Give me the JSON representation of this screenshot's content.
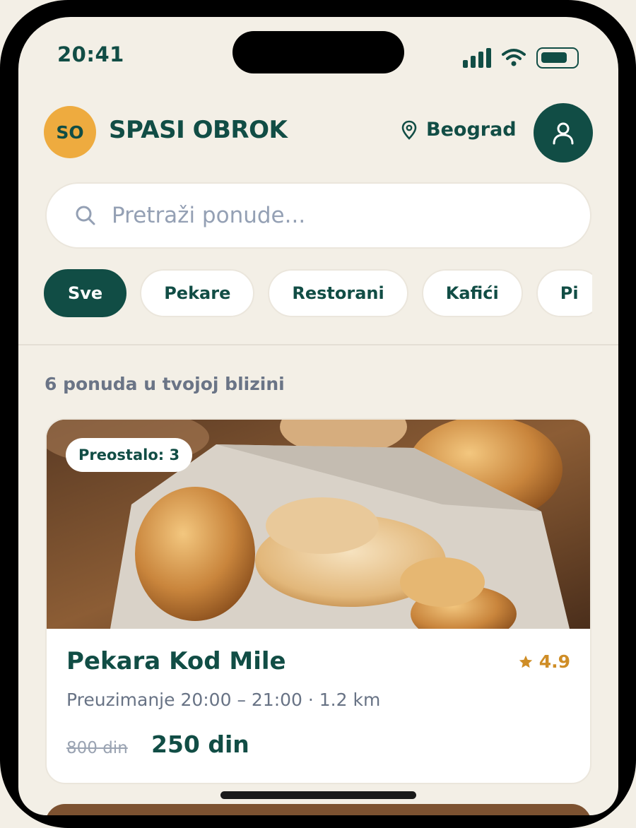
{
  "status_bar": {
    "time": "20:41"
  },
  "header": {
    "logo_initials": "SO",
    "brand": "SPASI OBROK",
    "location": "Beograd"
  },
  "search": {
    "placeholder": "Pretraži ponude..."
  },
  "categories": [
    "Sve",
    "Pekare",
    "Restorani",
    "Kafići",
    "Pi"
  ],
  "results_count_text": "6 ponuda u tvojoj blizini",
  "offer": {
    "remaining": "Preostalo: 3",
    "name": "Pekara Kod Mile",
    "rating": "4.9",
    "pickup": "Preuzimanje 20:00 – 21:00 · 1.2 km",
    "old_price": "800 din",
    "new_price": "250 din"
  },
  "colors": {
    "primary": "#114d45",
    "accent": "#eeab3f",
    "rating": "#cf8d26",
    "background": "#f3efe6"
  }
}
